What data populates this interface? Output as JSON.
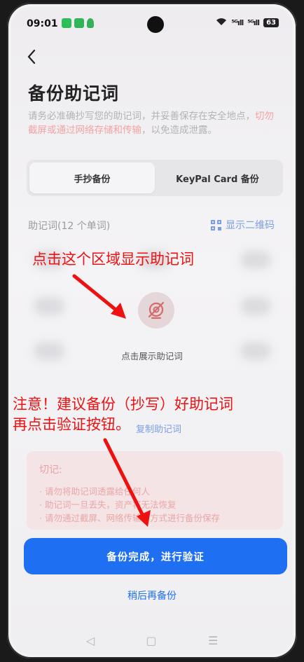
{
  "status_bar": {
    "time": "09:01",
    "signal1": "⁵ᴳıll",
    "signal2": "⁵ᴳıll",
    "battery": "63"
  },
  "header": {
    "back_icon": "chevron-left-icon",
    "title": "备份助记词",
    "desc_before": "请务必准确抄写您的助记词，并妥善保存在安全地点，",
    "desc_warn": "切勿截屏或通过网络存储和传输",
    "desc_after": "，以免造成泄露。"
  },
  "tabs": [
    {
      "label": "手抄备份",
      "active": true
    },
    {
      "label": "KeyPal Card 备份",
      "active": false
    }
  ],
  "words": {
    "label": "助记词(12 个单词)",
    "qr_label": "显示二维码",
    "reveal_text": "点击展示助记词",
    "copy_label": "复制助记词"
  },
  "caution": {
    "title": "切记:",
    "items": [
      "· 请勿将助记词透露给任何人",
      "· 助记词一旦丢失，资产将无法恢复",
      "· 请勿通过截屏、网络传输的方式进行备份保存"
    ]
  },
  "actions": {
    "primary": "备份完成，进行验证",
    "secondary": "稍后再备份"
  },
  "navbar": {
    "back": "◁",
    "home": "▢",
    "menu": "☰"
  },
  "annotations": {
    "tap_area": "点击这个区域显示助记词",
    "note_line1": "注意！建议备份（抄写）好助记词",
    "note_line2": "再点击验证按钮。"
  },
  "colors": {
    "primary": "#1f6ff3",
    "annotation": "#ee1111",
    "link": "#7a9ee6"
  }
}
